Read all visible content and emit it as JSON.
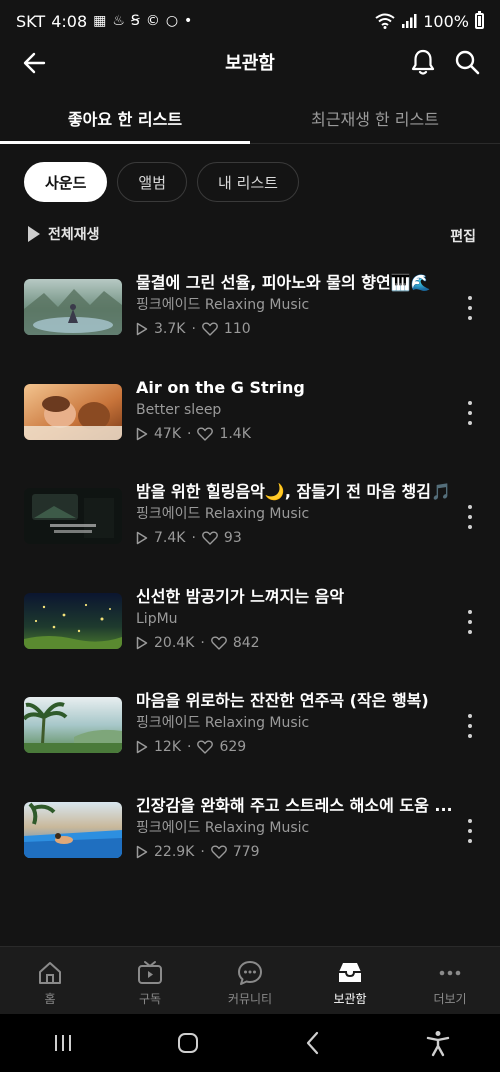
{
  "status_bar": {
    "carrier": "SKT",
    "time": "4:08",
    "dot": "•",
    "battery": "100%"
  },
  "header": {
    "title": "보관함"
  },
  "tabs": [
    {
      "label": "좋아요 한 리스트",
      "active": true
    },
    {
      "label": "최근재생 한 리스트",
      "active": false
    }
  ],
  "chips": [
    {
      "label": "사운드",
      "active": true
    },
    {
      "label": "앨범",
      "active": false
    },
    {
      "label": "내 리스트",
      "active": false
    }
  ],
  "actions": {
    "play_all": "전체재생",
    "edit": "편집"
  },
  "items": [
    {
      "title": "물결에 그린 선율, 피아노와 물의 향연🎹🌊",
      "artist": "핑크에이드 Relaxing Music",
      "plays": "3.7K",
      "likes": "110"
    },
    {
      "title": "Air on the G String",
      "artist": "Better sleep",
      "plays": "47K",
      "likes": "1.4K"
    },
    {
      "title": "밤을 위한 힐링음악🌙, 잠들기 전 마음 챙김🎵",
      "artist": "핑크에이드 Relaxing Music",
      "plays": "7.4K",
      "likes": "93"
    },
    {
      "title": "신선한 밤공기가 느껴지는 음악",
      "artist": "LipMu",
      "plays": "20.4K",
      "likes": "842"
    },
    {
      "title": "마음을 위로하는 잔잔한 연주곡 (작은 행복)",
      "artist": "핑크에이드 Relaxing Music",
      "plays": "12K",
      "likes": "629"
    },
    {
      "title": "긴장감을 완화해 주고 스트레스 해소에 도움 ...",
      "artist": "핑크에이드 Relaxing Music",
      "plays": "22.9K",
      "likes": "779"
    }
  ],
  "bottom_nav": [
    {
      "label": "홈",
      "icon": "home-icon",
      "active": false
    },
    {
      "label": "구독",
      "icon": "subscription-icon",
      "active": false
    },
    {
      "label": "커뮤니티",
      "icon": "community-icon",
      "active": false
    },
    {
      "label": "보관함",
      "icon": "library-icon",
      "active": true
    },
    {
      "label": "더보기",
      "icon": "more-icon",
      "active": false
    }
  ],
  "colors": {
    "background": "#141414",
    "text_secondary": "#9a9a9a",
    "active_chip": "#ffffff"
  }
}
